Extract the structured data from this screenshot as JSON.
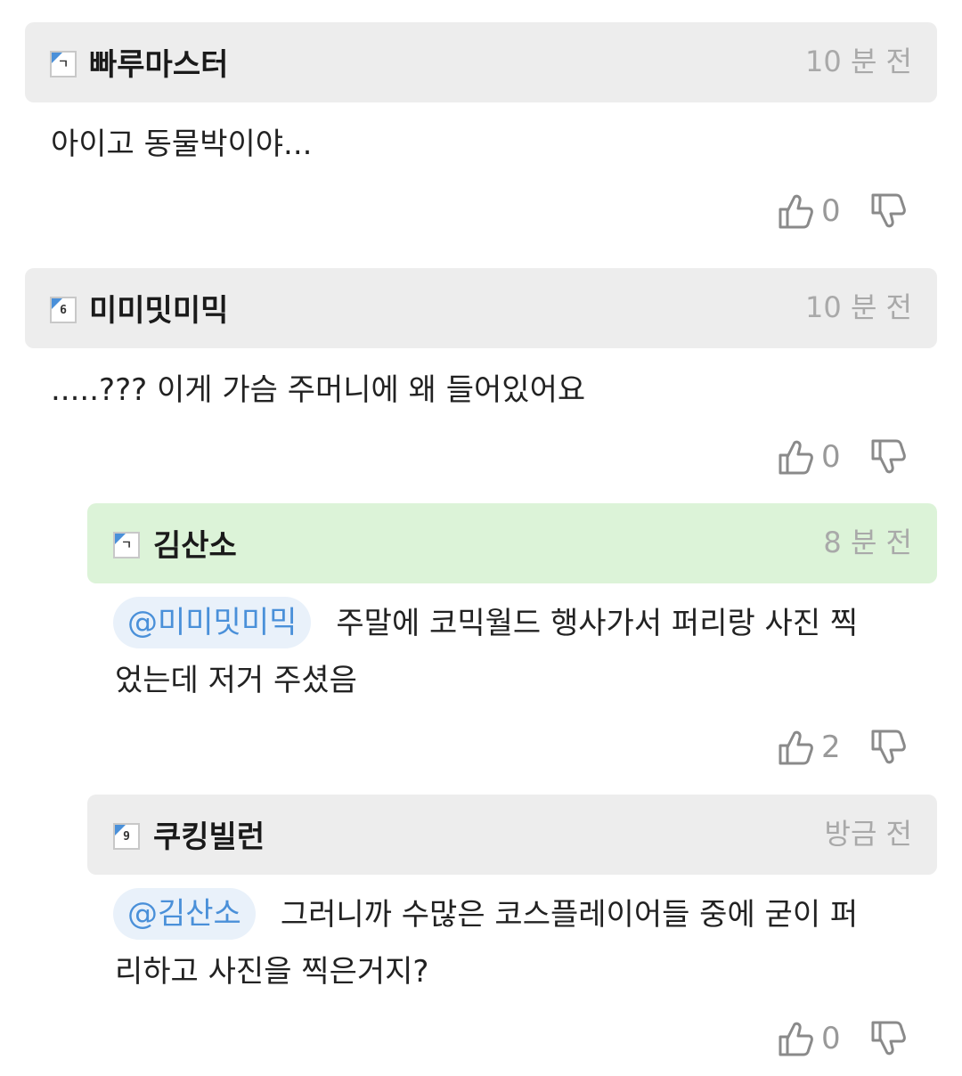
{
  "comments": [
    {
      "level": "ㄱ",
      "username": "빠루마스터",
      "time": "10 분 전",
      "text": "아이고 동물박이야...",
      "likes": "0",
      "icons": {
        "like": "thumbs-up-icon",
        "dislike": "thumbs-down-icon"
      }
    },
    {
      "level": "6",
      "username": "미미밋미믹",
      "time": "10 분 전",
      "text": ".....??? 이게 가슴 주머니에 왜 들어있어요",
      "likes": "0",
      "icons": {
        "like": "thumbs-up-icon",
        "dislike": "thumbs-down-icon"
      }
    },
    {
      "level": "ㄱ",
      "username": "김산소",
      "time": "8 분 전",
      "mention": "@미미밋미믹",
      "text_line1": "주말에 코믹월드 행사가서 퍼리랑 사진 찍",
      "text_line2": "었는데 저거 주셨음",
      "likes": "2",
      "highlight_color": "#dcf3d8",
      "icons": {
        "like": "thumbs-up-icon",
        "dislike": "thumbs-down-icon"
      }
    },
    {
      "level": "9",
      "username": "쿠킹빌런",
      "time": "방금 전",
      "mention": "@김산소",
      "text_line1": "그러니까 수많은 코스플레이어들 중에 굳이 퍼",
      "text_line2": "리하고 사진을 찍은거지?",
      "likes": "0",
      "icons": {
        "like": "thumbs-up-icon",
        "dislike": "thumbs-down-icon"
      }
    }
  ],
  "colors": {
    "header_bg": "#ededed",
    "mention_text": "#4a90d9",
    "mention_bg": "#e9f1fa",
    "time_text": "#a9a9a9"
  }
}
